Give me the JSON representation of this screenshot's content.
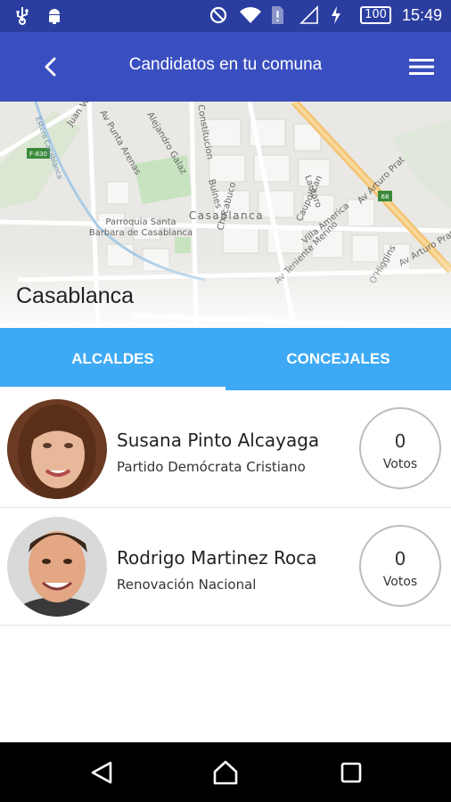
{
  "status_bar": {
    "time": "15:49",
    "battery": "100",
    "icons": [
      "usb-icon",
      "android-icon",
      "do-not-disturb-icon",
      "wifi-icon",
      "sim-alert-icon",
      "signal-icon",
      "charging-icon",
      "battery-icon"
    ]
  },
  "app_bar": {
    "title": "Candidatos en tu comuna",
    "back_icon": "arrow-back-icon",
    "menu_icon": "hamburger-menu-icon"
  },
  "map": {
    "commune": "Casablanca",
    "labels": {
      "town": "Casablanca",
      "church_line1": "Parroquia Santa",
      "church_line2": "Barbara de Casablanca",
      "st1": "Juan Verdaguer",
      "st2": "Av Punta Arenas",
      "st3": "Alejandro Galaz",
      "st4": "Constitucion",
      "st5": "Bulnes",
      "st6": "Chacabuco",
      "st7": "Lautaro",
      "st8": "Caupolican",
      "st9": "Villa America",
      "st10": "Av Arturo Prat",
      "st11": "Av Teniente Merino",
      "st12": "Av Arturo Prat",
      "st13": "Estero Casablanca",
      "st14": "O'Higgins",
      "shield1": "F-830",
      "shield2": "68"
    }
  },
  "tabs": [
    {
      "label": "ALCALDES",
      "active": true
    },
    {
      "label": "CONCEJALES",
      "active": false
    }
  ],
  "candidates": [
    {
      "name": "Susana Pinto Alcayaga",
      "party": "Partido Demócrata Cristiano",
      "votes": "0",
      "votes_label": "Votos"
    },
    {
      "name": "Rodrigo Martinez Roca",
      "party": "Renovación Nacional",
      "votes": "0",
      "votes_label": "Votos"
    }
  ],
  "colors": {
    "status_bar": "#2b3ea0",
    "app_bar": "#3a4fbf",
    "tabs": "#3eaaf5"
  },
  "nav_bar": {
    "icons": [
      "back-triangle-icon",
      "home-icon",
      "recents-icon"
    ]
  }
}
